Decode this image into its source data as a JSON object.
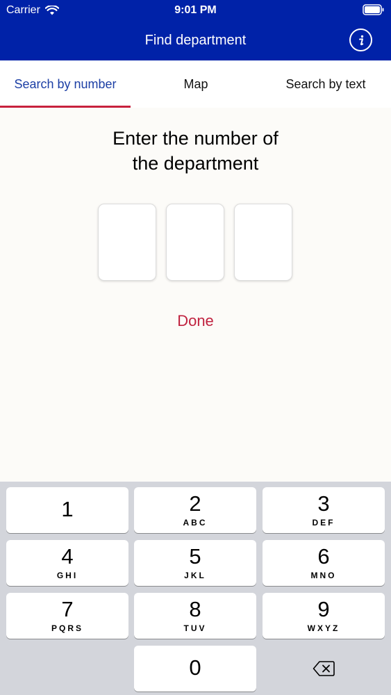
{
  "status_bar": {
    "carrier": "Carrier",
    "time": "9:01 PM",
    "icons": [
      "wifi-icon",
      "battery-icon"
    ]
  },
  "nav": {
    "title": "Find department",
    "info_icon": "info-icon"
  },
  "tabs": [
    {
      "label": "Search by number",
      "active": true
    },
    {
      "label": "Map",
      "active": false
    },
    {
      "label": "Search by text",
      "active": false
    }
  ],
  "main": {
    "prompt_line1": "Enter the number of",
    "prompt_line2": "the department",
    "digits": [
      "",
      "",
      ""
    ],
    "done_label": "Done"
  },
  "keyboard": {
    "keys": [
      {
        "number": "1",
        "letters": ""
      },
      {
        "number": "2",
        "letters": "ABC"
      },
      {
        "number": "3",
        "letters": "DEF"
      },
      {
        "number": "4",
        "letters": "GHI"
      },
      {
        "number": "5",
        "letters": "JKL"
      },
      {
        "number": "6",
        "letters": "MNO"
      },
      {
        "number": "7",
        "letters": "PQRS"
      },
      {
        "number": "8",
        "letters": "TUV"
      },
      {
        "number": "9",
        "letters": "WXYZ"
      },
      {
        "number": "0",
        "letters": ""
      }
    ],
    "delete_icon": "backspace-icon"
  },
  "colors": {
    "header_bg": "#0022a8",
    "accent_red": "#c0223f",
    "active_tab_text": "#1c3fa5",
    "page_bg": "#fcfbf8",
    "keyboard_bg": "#d3d5db"
  }
}
